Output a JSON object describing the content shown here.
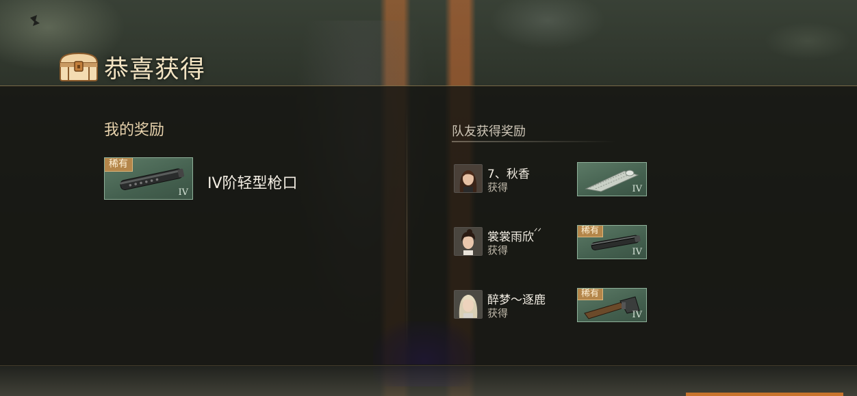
{
  "header": {
    "title": "恭喜获得",
    "icon": "treasure-chest-icon"
  },
  "my_rewards": {
    "title": "我的奖励",
    "item": {
      "rarity_badge": "稀有",
      "tier": "IV",
      "name": "IV阶轻型枪口",
      "icon": "muzzle-suppressor-icon",
      "card_color": "#4f6e5a"
    }
  },
  "team_rewards": {
    "title": "队友获得奖励",
    "members": [
      {
        "name": "7、秋香",
        "status": "获得",
        "avatar": "female-avatar-brown-hair-icon",
        "item": {
          "rarity_badge": "",
          "tier": "IV",
          "icon": "ghillie-cloth-icon"
        }
      },
      {
        "name": "裳裳雨欣",
        "status": "获得",
        "avatar": "female-avatar-dark-hair-icon",
        "item": {
          "rarity_badge": "稀有",
          "tier": "IV",
          "icon": "muzzle-suppressor-icon"
        }
      },
      {
        "name": "醉梦～逐鹿",
        "status": "获得",
        "avatar": "female-avatar-blonde-hair-icon",
        "item": {
          "rarity_badge": "稀有",
          "tier": "IV",
          "icon": "rifle-stock-icon"
        }
      }
    ]
  },
  "colors": {
    "title_text": "#f2e3c2",
    "badge": "#b4864a",
    "card_green": "#4f6e5a",
    "accent_orange": "#c8742c"
  }
}
